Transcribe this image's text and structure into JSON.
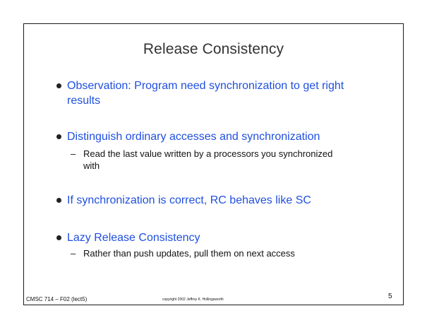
{
  "slide": {
    "title": "Release Consistency",
    "bullets": [
      {
        "text": "Observation: Program need synchronization to get right results"
      },
      {
        "text": "Distinguish ordinary accesses and synchronization",
        "sub": "Read the last value written by a processors you synchronized with"
      },
      {
        "text": "If synchronization is correct, RC behaves like SC"
      },
      {
        "text": "Lazy Release Consistency",
        "sub": "Rather than push updates, pull them on next access"
      }
    ],
    "dash": "–",
    "footer": {
      "course": "CMSC 714 – F02 (lect5)",
      "copyright": "copyright 2002 Jeffrey K. Hollingsworth",
      "page": "5"
    }
  }
}
